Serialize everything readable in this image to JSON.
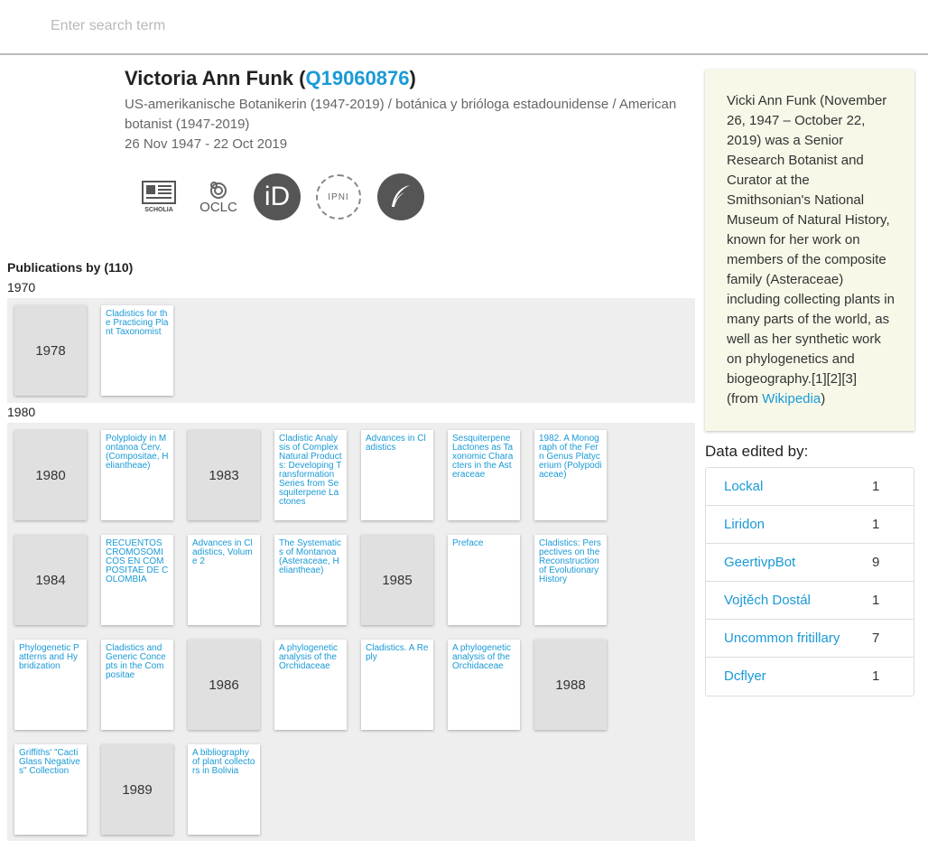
{
  "search": {
    "placeholder": "Enter search term"
  },
  "person": {
    "name": "Victoria Ann Funk",
    "qid": "Q19060876",
    "description": "US-amerikanische Botanikerin (1947-2019) / botánica y brióloga estadounidense / American botanist (1947-2019)",
    "dates": "26 Nov 1947 - 22 Oct 2019"
  },
  "icons": {
    "scholia": {
      "name": "scholia-icon",
      "label": "SCHOLIA"
    },
    "oclc": {
      "name": "oclc-icon",
      "label": "OCLC"
    },
    "orcid": {
      "name": "orcid-icon",
      "label": "iD"
    },
    "ipni": {
      "name": "ipni-icon",
      "label": "IPNI"
    },
    "wiki": {
      "name": "wikipedia-quill-icon"
    }
  },
  "publications": {
    "heading": "Publications by (110)",
    "decades": [
      {
        "label": "1970",
        "rows": [
          [
            {
              "type": "year",
              "text": "1978"
            },
            {
              "type": "pub",
              "text": "Cladistics for the Practicing Plant Taxonomist"
            }
          ]
        ]
      },
      {
        "label": "1980",
        "rows": [
          [
            {
              "type": "year",
              "text": "1980"
            },
            {
              "type": "pub",
              "text": "Polyploidy in Montanoa Cerv. (Compositae, Heliantheae)"
            },
            {
              "type": "year",
              "text": "1983"
            },
            {
              "type": "pub",
              "text": "Cladistic Analysis of Complex Natural Products: Developing Transformation Series from Sesquiterpene Lactones"
            },
            {
              "type": "pub",
              "text": "Advances in Cladistics"
            },
            {
              "type": "pub",
              "text": "Sesquiterpene Lactones as Taxonomic Characters in the Asteraceae"
            },
            {
              "type": "pub",
              "text": "1982. A Monograph of the Fern Genus Platycerium (Polypodiaceae)"
            }
          ],
          [
            {
              "type": "year",
              "text": "1984"
            },
            {
              "type": "pub",
              "text": "RECUENTOS CROMOSOMICOS EN COMPOSITAE DE COLOMBIA"
            },
            {
              "type": "pub",
              "text": "Advances in Cladistics, Volume 2"
            },
            {
              "type": "pub",
              "text": "The Systematics of Montanoa (Asteraceae, Heliantheae)"
            },
            {
              "type": "year",
              "text": "1985"
            },
            {
              "type": "pub",
              "text": "Preface"
            },
            {
              "type": "pub",
              "text": "Cladistics: Perspectives on the Reconstruction of Evolutionary History"
            }
          ],
          [
            {
              "type": "pub",
              "text": "Phylogenetic Patterns and Hybridization"
            },
            {
              "type": "pub",
              "text": "Cladistics and Generic Concepts in the Compositae"
            },
            {
              "type": "year",
              "text": "1986"
            },
            {
              "type": "pub",
              "text": "A phylogenetic analysis of the Orchidaceae"
            },
            {
              "type": "pub",
              "text": "Cladistics. A Reply"
            },
            {
              "type": "pub",
              "text": "A phylogenetic analysis of the Orchidaceae"
            },
            {
              "type": "year",
              "text": "1988"
            }
          ],
          [
            {
              "type": "pub",
              "text": "Griffiths' \"Cacti Glass Negatives\" Collection"
            },
            {
              "type": "year",
              "text": "1989"
            },
            {
              "type": "pub",
              "text": "A bibliography of plant collectors in Bolivia"
            }
          ]
        ]
      }
    ]
  },
  "wikipedia": {
    "summary": "Vicki Ann Funk (November 26, 1947 – October 22, 2019) was a Senior Research Botanist and Curator at the Smithsonian's National Museum of Natural History, known for her work on members of the composite family (Asteraceae) including collecting plants in many parts of the world, as well as her synthetic work on phylogenetics and biogeography.[1][2][3]",
    "from_prefix": "(from ",
    "link_text": "Wikipedia",
    "from_suffix": ")"
  },
  "editors": {
    "heading": "Data edited by:",
    "rows": [
      {
        "name": "Lockal",
        "count": "1"
      },
      {
        "name": "Liridon",
        "count": "1"
      },
      {
        "name": "GeertivpBot",
        "count": "9"
      },
      {
        "name": "Vojtěch Dostál",
        "count": "1"
      },
      {
        "name": "Uncommon fritillary",
        "count": "7"
      },
      {
        "name": "Dcflyer",
        "count": "1"
      }
    ]
  }
}
